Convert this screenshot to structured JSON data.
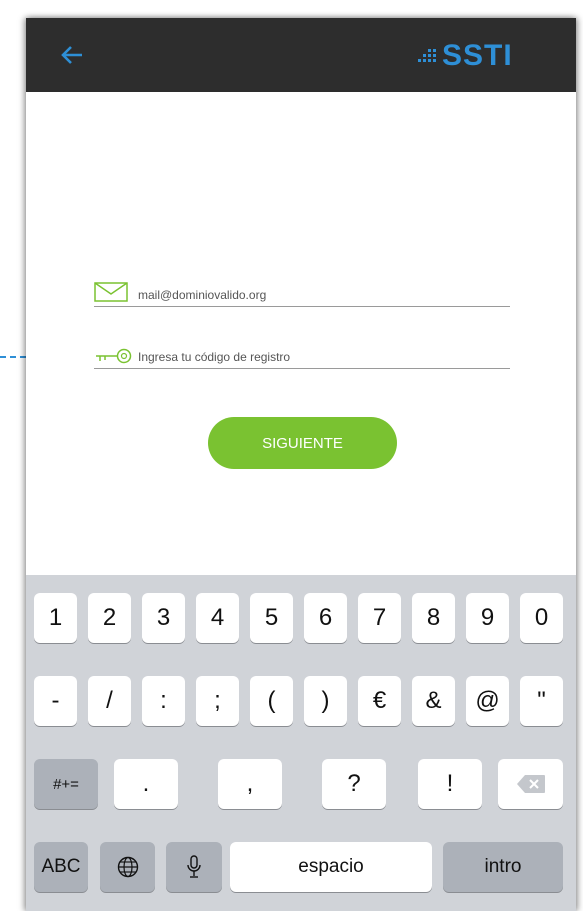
{
  "header": {
    "back_icon": "left-arrow-icon",
    "logo_text": "SSTI"
  },
  "form": {
    "email_placeholder": "mail@dominiovalido.org",
    "code_placeholder": "Ingresa tu código de registro",
    "submit_label": "SIGUIENTE"
  },
  "keyboard": {
    "row1": [
      "1",
      "2",
      "3",
      "4",
      "5",
      "6",
      "7",
      "8",
      "9",
      "0"
    ],
    "row2": [
      "-",
      "/",
      ":",
      ";",
      "(",
      ")",
      "€",
      "&",
      "@",
      "\""
    ],
    "row3_left": "#+=",
    "row3": [
      ".",
      ",",
      "?",
      "!",
      "'"
    ],
    "abc": "ABC",
    "space": "espacio",
    "return": "intro"
  },
  "colors": {
    "header_bg": "#2d2d2d",
    "accent_green": "#7ac231",
    "logo_blue": "#2e8fd6",
    "annotation_blue": "#2e8fd6"
  }
}
